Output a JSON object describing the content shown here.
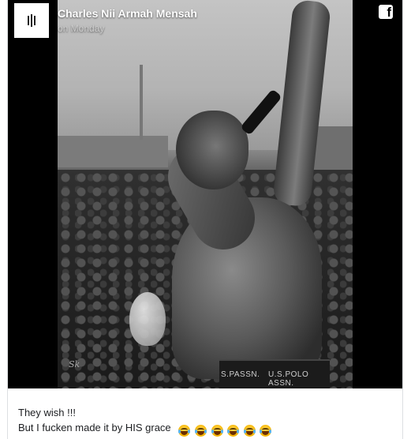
{
  "post": {
    "author": "Charles Nii Armah Mensah",
    "timestamp": "on Monday",
    "platform_icon": "facebook-icon",
    "photo_watermark": "Sk",
    "waistband_text_left": "S.PASSN.",
    "waistband_text_right": "U.S.POLO ASSN.",
    "caption_line1": "They wish !!!",
    "caption_line2": "But I fucken made it by HIS grace",
    "emoji_name": "face-with-tears-of-joy-icon",
    "emoji_count": 6
  },
  "colors": {
    "media_background": "#000000",
    "author_text": "#ffffff",
    "caption_text": "#1c1e21",
    "border": "#dddfe2"
  }
}
